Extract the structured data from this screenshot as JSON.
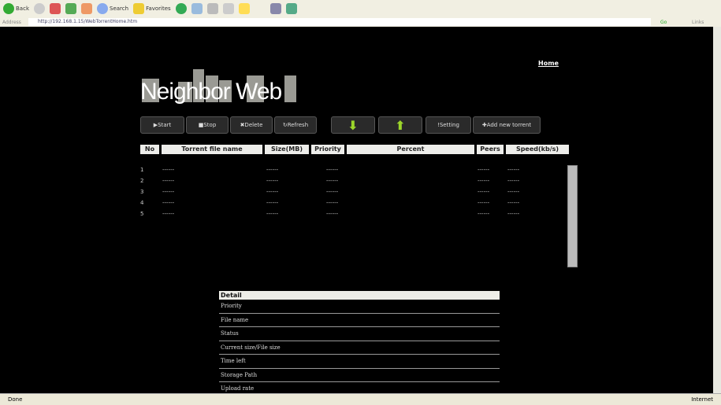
{
  "browser": {
    "back": "Back",
    "search": "Search",
    "favorites": "Favorites",
    "address_label": "Address",
    "url": "http://192.168.1.15/WebTorrentHome.htm",
    "go": "Go",
    "links": "Links",
    "status": "Done",
    "zone": "Internet"
  },
  "page": {
    "home": "Home",
    "logo": "Neighbor Web"
  },
  "buttons": {
    "start": "▶Start",
    "stop": "■Stop",
    "delete": "✖Delete",
    "refresh": "↻Refresh",
    "down": "⬇",
    "up": "⬆",
    "setting": "!Setting",
    "add": "✚Add new torrent"
  },
  "table": {
    "headers": [
      "No",
      "Torrent file name",
      "Size(MB)",
      "Priority",
      "Percent",
      "Peers",
      "Speed(kb/s)"
    ],
    "rows": [
      {
        "no": "1",
        "name": "------",
        "size": "------",
        "priority": "------",
        "peers": "------",
        "speed": "------"
      },
      {
        "no": "2",
        "name": "------",
        "size": "------",
        "priority": "------",
        "peers": "------",
        "speed": "------"
      },
      {
        "no": "3",
        "name": "------",
        "size": "------",
        "priority": "------",
        "peers": "------",
        "speed": "------"
      },
      {
        "no": "4",
        "name": "------",
        "size": "------",
        "priority": "------",
        "peers": "------",
        "speed": "------"
      },
      {
        "no": "5",
        "name": "------",
        "size": "------",
        "priority": "------",
        "peers": "------",
        "speed": "------"
      }
    ]
  },
  "detail": {
    "title": "Detail",
    "items": [
      "Priority",
      "File name",
      "Status",
      "Current size/File size",
      "Time left",
      "Storage Path",
      "Upload rate"
    ]
  }
}
